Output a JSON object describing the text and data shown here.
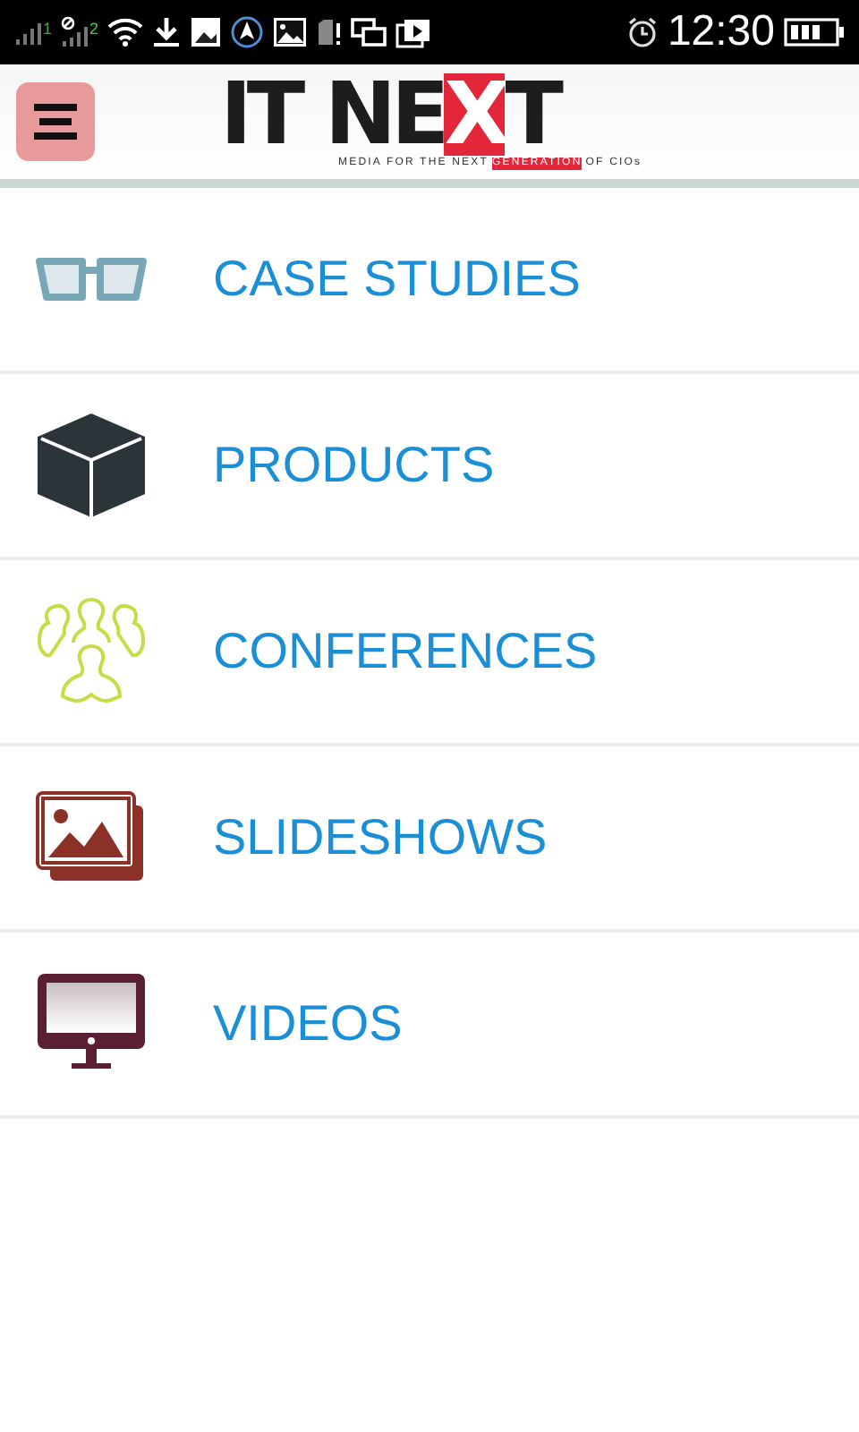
{
  "status_bar": {
    "time": "12:30",
    "sim_labels": [
      "1",
      "2"
    ]
  },
  "header": {
    "logo": [
      {
        "text": "IT NE",
        "highlight": false
      },
      {
        "text": "X",
        "highlight": true
      },
      {
        "text": "T",
        "highlight": false
      }
    ],
    "tagline": [
      {
        "text": "MEDIA FOR THE NEXT",
        "highlight": false
      },
      {
        "text": "GENERATION",
        "highlight": true
      },
      {
        "text": "OF CIOs",
        "highlight": false
      }
    ]
  },
  "menu": [
    {
      "label": "CASE STUDIES",
      "kind": "glasses"
    },
    {
      "label": "PRODUCTS",
      "kind": "cube"
    },
    {
      "label": "CONFERENCES",
      "kind": "people"
    },
    {
      "label": "SLIDESHOWS",
      "kind": "images"
    },
    {
      "label": "VIDEOS",
      "kind": "monitor"
    }
  ]
}
